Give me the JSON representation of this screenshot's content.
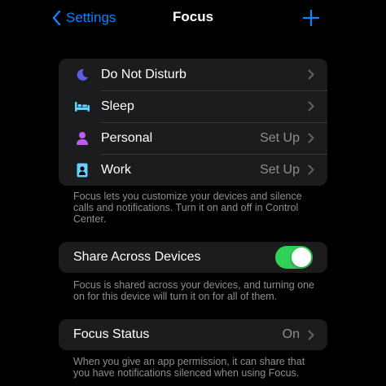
{
  "nav": {
    "back_label": "Settings",
    "title": "Focus"
  },
  "focus_modes": [
    {
      "label": "Do Not Disturb",
      "value": "",
      "icon": "moon-icon",
      "color": "#5e5ce6"
    },
    {
      "label": "Sleep",
      "value": "",
      "icon": "bed-icon",
      "color": "#64d2ff"
    },
    {
      "label": "Personal",
      "value": "Set Up",
      "icon": "person-icon",
      "color": "#bf5af2"
    },
    {
      "label": "Work",
      "value": "Set Up",
      "icon": "id-badge-icon",
      "color": "#64d2ff"
    }
  ],
  "focus_footer": "Focus lets you customize your devices and silence calls and notifications. Turn it on and off in Control Center.",
  "share": {
    "label": "Share Across Devices",
    "enabled": true
  },
  "share_footer": "Focus is shared across your devices, and turning one on for this device will turn it on for all of them.",
  "status": {
    "label": "Focus Status",
    "value": "On"
  },
  "status_footer": "When you give an app permission, it can share that you have notifications silenced when using Focus.",
  "colors": {
    "accent": "#0a84ff",
    "toggle_on": "#30d158",
    "group_bg": "#1c1c1e",
    "secondary_text": "#8e8e93"
  }
}
